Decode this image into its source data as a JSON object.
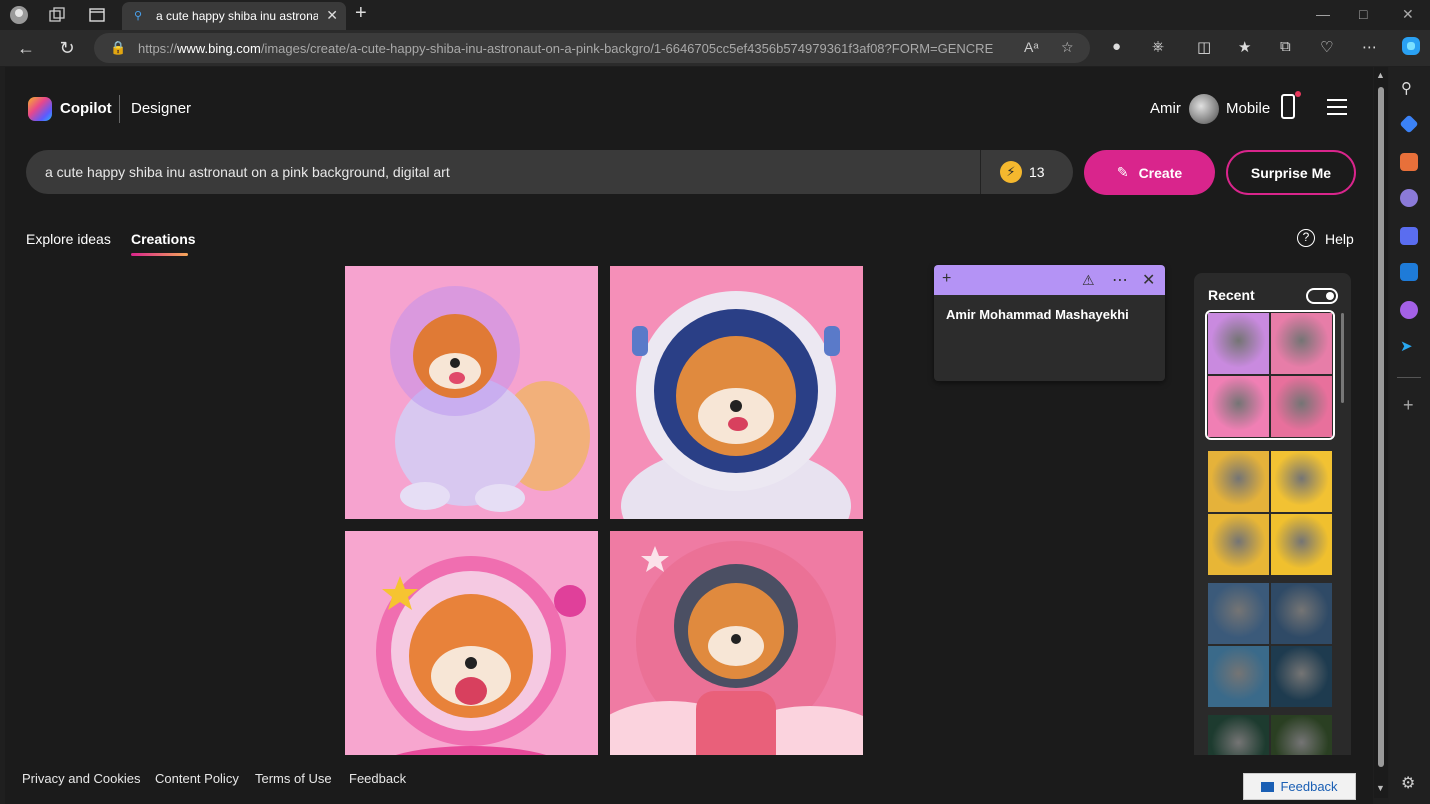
{
  "browser": {
    "tab_title": "a cute happy shiba inu astronaut on a pink background, digital art",
    "url_prefix": "https://",
    "url_domain": "www.bing.com",
    "url_path": "/images/create/a-cute-happy-shiba-inu-astronaut-on-a-pink-backgro/1-6646705cc5ef4356b574979361f3af08?FORM=GENCRE",
    "read_aloud_glyph": "Aᵃ"
  },
  "header": {
    "brand": "Copilot",
    "product": "Designer",
    "user_name": "Amir",
    "mobile_label": "Mobile"
  },
  "prompt": {
    "text": "a cute happy shiba inu astronaut on a pink background, digital art",
    "boosts": "13"
  },
  "buttons": {
    "create": "Create",
    "surprise": "Surprise Me"
  },
  "nav": {
    "explore": "Explore ideas",
    "creations": "Creations",
    "help": "Help"
  },
  "images": [
    {
      "alt": "shiba astronaut sitting",
      "bg": "#f6a3cf"
    },
    {
      "alt": "shiba astronaut portrait",
      "bg": "#f58fb8"
    },
    {
      "alt": "shiba astronaut with stars",
      "bg": "#f7a6cf"
    },
    {
      "alt": "shiba astronaut in pink suit",
      "bg": "#ef7ba3"
    }
  ],
  "sticky_note": {
    "text": "Amir Mohammad Mashayekhi"
  },
  "recent": {
    "title": "Recent",
    "groups": [
      {
        "colors": [
          "#c98adf",
          "#e77da8",
          "#f07fb4",
          "#e8709c"
        ]
      },
      {
        "colors": [
          "#e5b23a",
          "#f2c233",
          "#e8b636",
          "#f0c02e"
        ]
      },
      {
        "colors": [
          "#3b5a7a",
          "#2f4a66",
          "#3a6a8a",
          "#1e3b4f"
        ]
      },
      {
        "colors": [
          "#1d3b2f",
          "#2a3f22",
          "#1a2e2a",
          "#33401f"
        ]
      }
    ]
  },
  "footer": {
    "privacy": "Privacy and Cookies",
    "content_policy": "Content Policy",
    "terms": "Terms of Use",
    "feedback": "Feedback",
    "feedback_button": "Feedback"
  },
  "colors": {
    "accent": "#d9258c",
    "sticky_header": "#b493f5"
  }
}
